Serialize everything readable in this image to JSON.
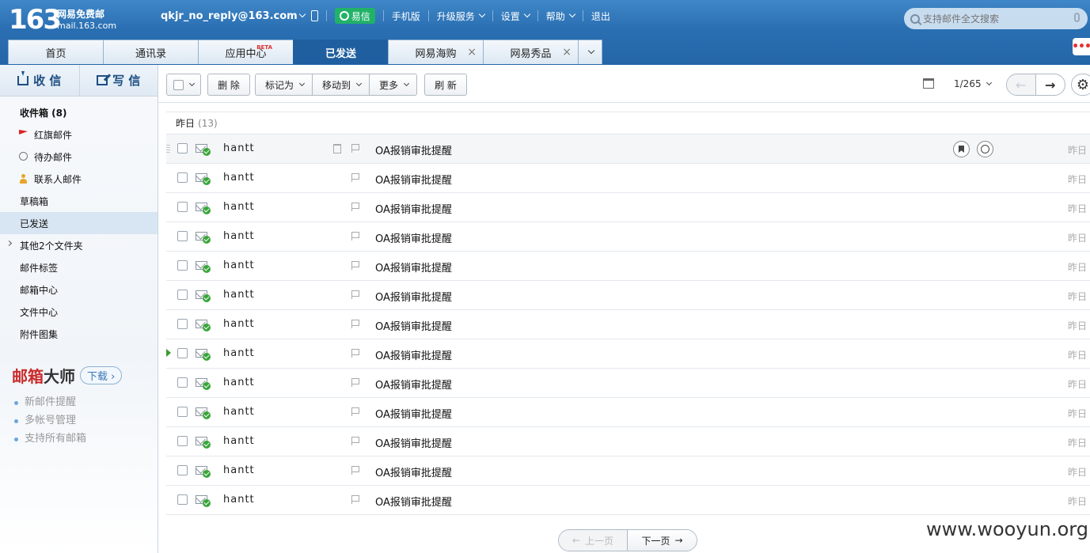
{
  "header": {
    "logo_number": "163",
    "logo_line1": "网易免费邮",
    "logo_line2": "mail.163.com",
    "user_email": "qkjr_no_reply@163.com",
    "yixin_label": "易信",
    "links": [
      "手机版",
      "升级服务",
      "设置",
      "帮助",
      "退出"
    ],
    "search_placeholder": "支持邮件全文搜索",
    "more_dots": "•••"
  },
  "tabs": [
    {
      "label": "首页"
    },
    {
      "label": "通讯录"
    },
    {
      "label": "应用中心",
      "badge": "BETA"
    },
    {
      "label": "已发送"
    },
    {
      "label": "网易海购",
      "close": "×"
    },
    {
      "label": "网易秀品",
      "close": "×"
    }
  ],
  "sidebar": {
    "receive_label": "收 信",
    "compose_label": "写 信",
    "folders": [
      {
        "label": "收件箱 (8)"
      },
      {
        "label": "红旗邮件"
      },
      {
        "label": "待办邮件"
      },
      {
        "label": "联系人邮件"
      },
      {
        "label": "草稿箱"
      },
      {
        "label": "已发送"
      },
      {
        "label": "其他2个文件夹"
      },
      {
        "label": "邮件标签"
      },
      {
        "label": "邮箱中心"
      },
      {
        "label": "文件中心"
      },
      {
        "label": "附件图集"
      }
    ],
    "promo": {
      "title_red": "邮箱",
      "title_dark": "大师",
      "download": "下载",
      "items": [
        "新邮件提醒",
        "多帐号管理",
        "支持所有邮箱"
      ]
    }
  },
  "toolbar": {
    "delete": "删 除",
    "mark_as": "标记为",
    "move_to": "移动到",
    "more": "更多",
    "refresh": "刷 新",
    "page_indicator": "1/265"
  },
  "list": {
    "group_label": "昨日",
    "group_count": "(13)",
    "rows": [
      {
        "sender": "hantt",
        "subject": "OA报销审批提醒",
        "date": "昨日"
      },
      {
        "sender": "hantt",
        "subject": "OA报销审批提醒",
        "date": "昨日"
      },
      {
        "sender": "hantt",
        "subject": "OA报销审批提醒",
        "date": "昨日"
      },
      {
        "sender": "hantt",
        "subject": "OA报销审批提醒",
        "date": "昨日"
      },
      {
        "sender": "hantt",
        "subject": "OA报销审批提醒",
        "date": "昨日"
      },
      {
        "sender": "hantt",
        "subject": "OA报销审批提醒",
        "date": "昨日"
      },
      {
        "sender": "hantt",
        "subject": "OA报销审批提醒",
        "date": "昨日"
      },
      {
        "sender": "hantt",
        "subject": "OA报销审批提醒",
        "date": "昨日"
      },
      {
        "sender": "hantt",
        "subject": "OA报销审批提醒",
        "date": "昨日"
      },
      {
        "sender": "hantt",
        "subject": "OA报销审批提醒",
        "date": "昨日"
      },
      {
        "sender": "hantt",
        "subject": "OA报销审批提醒",
        "date": "昨日"
      },
      {
        "sender": "hantt",
        "subject": "OA报销审批提醒",
        "date": "昨日"
      },
      {
        "sender": "hantt",
        "subject": "OA报销审批提醒",
        "date": "昨日"
      }
    ]
  },
  "pagination": {
    "prev": "上一页",
    "next": "下一页"
  },
  "watermark": "www.wooyun.org"
}
